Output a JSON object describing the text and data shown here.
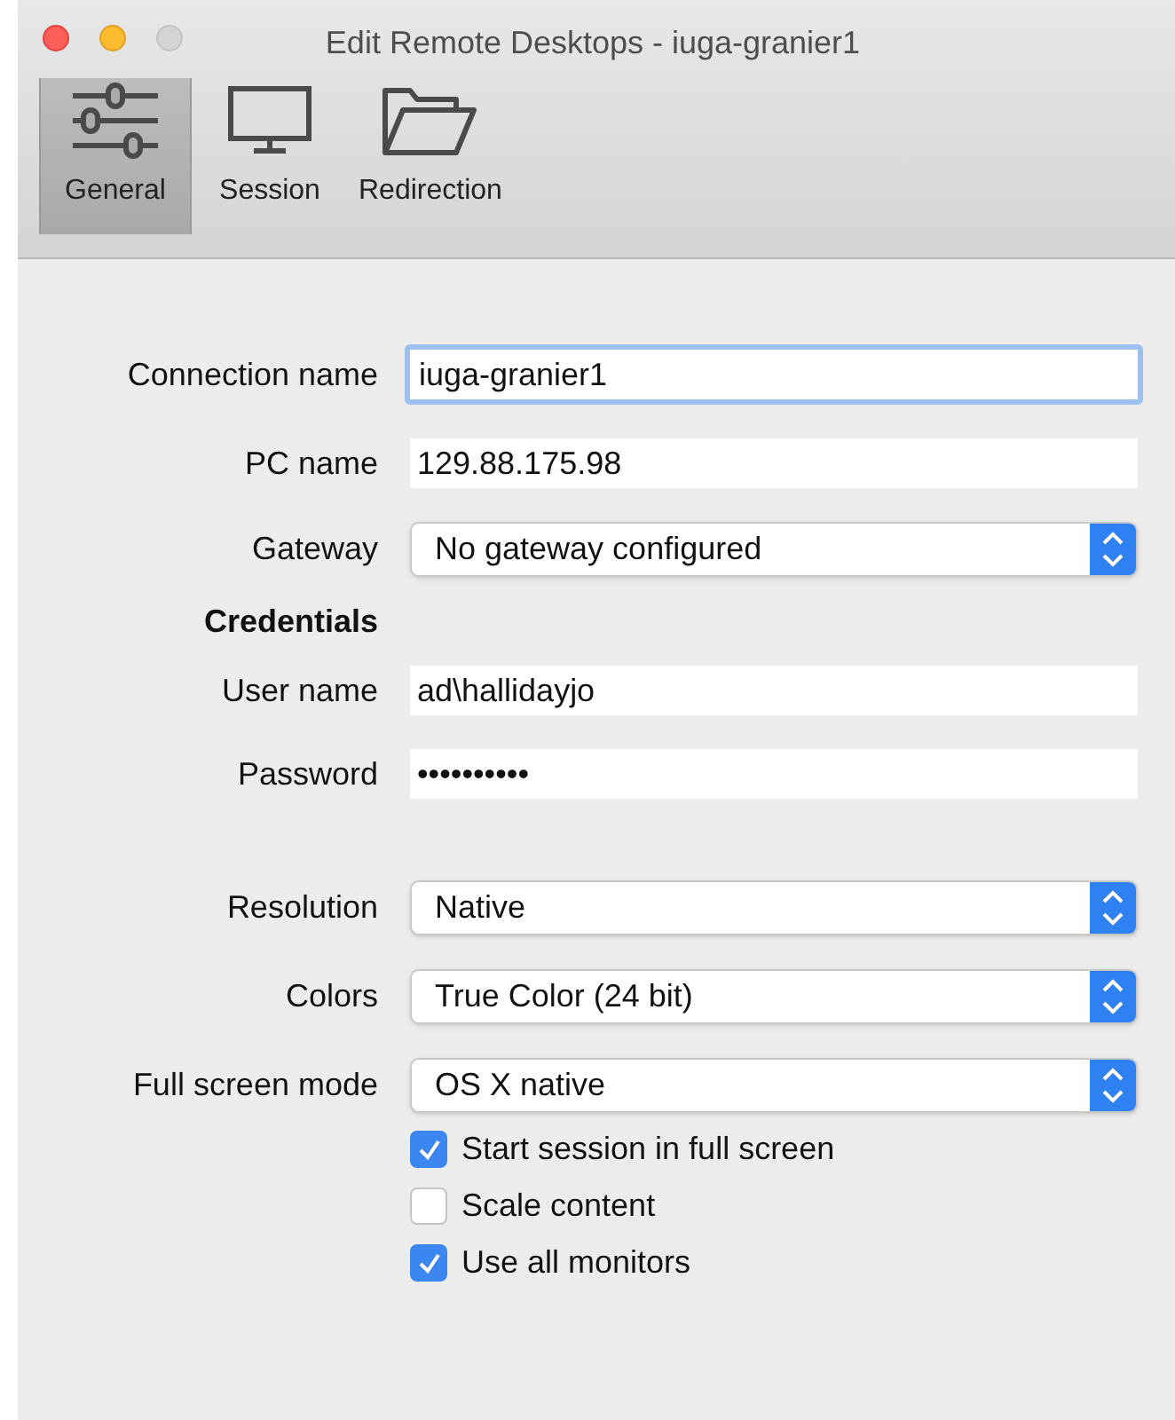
{
  "window": {
    "title": "Edit Remote Desktops - iuga-granier1"
  },
  "toolbar": {
    "tabs": [
      {
        "kind": "sliders",
        "label": "General",
        "selected": true
      },
      {
        "kind": "monitor",
        "label": "Session",
        "selected": false
      },
      {
        "kind": "folder",
        "label": "Redirection",
        "selected": false
      }
    ]
  },
  "sections": [
    {
      "rows": [
        {
          "kind": "text",
          "label": "Connection name",
          "value": "iuga-granier1",
          "focused": true
        },
        {
          "kind": "text",
          "label": "PC name",
          "value": "129.88.175.98",
          "focused": false
        },
        {
          "kind": "select",
          "label": "Gateway",
          "value": "No gateway configured"
        },
        {
          "kind": "heading",
          "label": "Credentials"
        },
        {
          "kind": "text",
          "label": "User name",
          "value": "ad\\hallidayjo",
          "focused": false
        },
        {
          "kind": "text",
          "label": "Password",
          "value": "••••••••••",
          "focused": false
        }
      ]
    },
    {
      "rows": [
        {
          "kind": "select",
          "label": "Resolution",
          "value": "Native"
        },
        {
          "kind": "select",
          "label": "Colors",
          "value": "True Color (24 bit)"
        },
        {
          "kind": "select",
          "label": "Full screen mode",
          "value": "OS X native"
        }
      ],
      "checkboxes": [
        {
          "label": "Start session in full screen",
          "checked": true
        },
        {
          "label": "Scale content",
          "checked": false
        },
        {
          "label": "Use all monitors",
          "checked": true
        }
      ]
    }
  ]
}
